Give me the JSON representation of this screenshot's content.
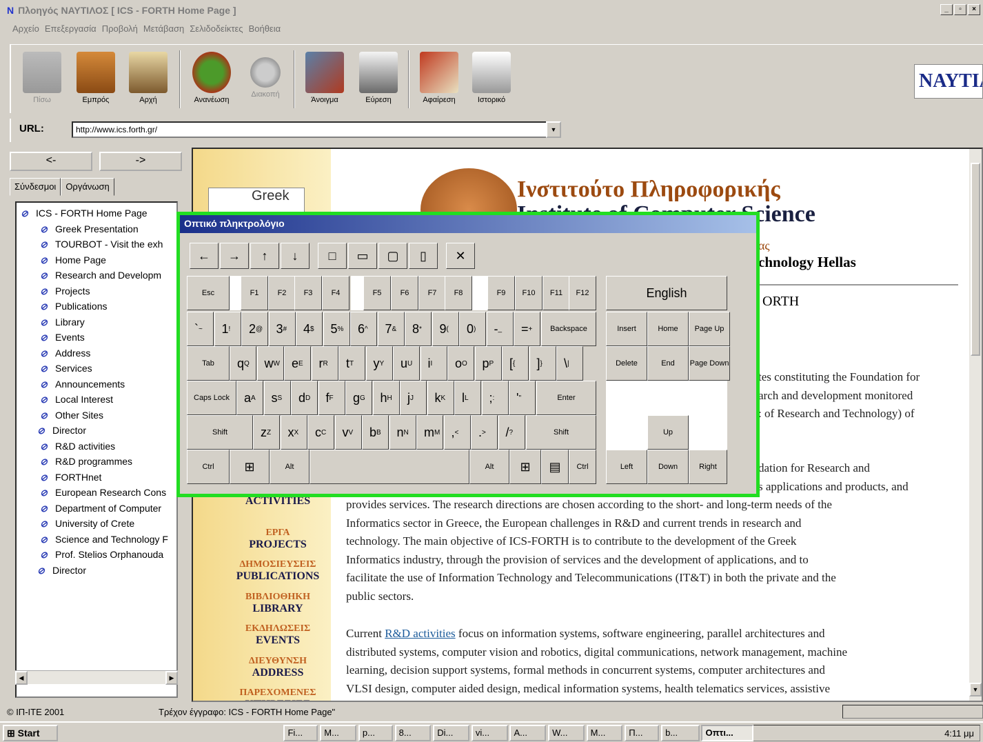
{
  "window": {
    "title": "Πλοηγός ΝΑΥΤΙΛΟΣ [ ICS - FORTH Home Page ]",
    "logo": "N",
    "controls": [
      "_",
      "▫",
      "×"
    ]
  },
  "menu": [
    "Αρχείο",
    "Επεξεργασία",
    "Προβολή",
    "Μετάβαση",
    "Σελιδοδείκτες",
    "Βοήθεια"
  ],
  "toolbar": {
    "buttons": [
      {
        "label": "Πίσω",
        "icon": "back-sign-icon",
        "disabled": true
      },
      {
        "label": "Εμπρός",
        "icon": "forward-sign-icon",
        "disabled": false
      },
      {
        "label": "Αρχή",
        "icon": "home-icon",
        "disabled": false
      },
      {
        "label": "Ανανέωση",
        "icon": "reload-icon",
        "disabled": false
      },
      {
        "label": "Διακοπή",
        "icon": "stop-icon",
        "disabled": true
      },
      {
        "label": "Άνοιγμα",
        "icon": "open-icon",
        "disabled": false
      },
      {
        "label": "Εύρεση",
        "icon": "find-icon",
        "disabled": false
      },
      {
        "label": "Αφαίρεση",
        "icon": "remove-icon",
        "disabled": false
      },
      {
        "label": "Ιστορικό",
        "icon": "history-icon",
        "disabled": false
      }
    ],
    "brand": "NAYTIΛΟΣ"
  },
  "url": {
    "label": "URL:",
    "value": "http://www.ics.forth.gr/"
  },
  "sidebar": {
    "back": "<-",
    "forward": "->",
    "tabs": [
      "Σύνδεσμοι",
      "Οργάνωση"
    ],
    "items": [
      "ICS - FORTH Home Page",
      "Greek Presentation",
      "TOURBOT - Visit the exh",
      "Home Page",
      "Research and Developm",
      "Projects",
      "Publications",
      "Library",
      "Events",
      "Address",
      "Services",
      "Announcements",
      "Local Interest",
      "Other Sites",
      "Director",
      "R&D activities",
      "R&D programmes",
      "FORTHnet",
      "European Research Cons",
      "Department of Computer",
      "University of Crete",
      "Science and Technology F",
      "Prof. Stelios Orphanouda",
      "Director"
    ]
  },
  "page": {
    "greek_logo": "Greek",
    "title_gr": "Ινστιτούτο Πληροφορικής",
    "title_en": "Institute of Computer Science",
    "sub1_gr": "ας",
    "sub1_en": "chnology Hellas",
    "sub2": "ORTH",
    "nav": [
      {
        "gr": "",
        "en": "ACTIVITIES"
      },
      {
        "gr": "ΕΡΓΑ",
        "en": "PROJECTS"
      },
      {
        "gr": "ΔΗΜΟΣΙΕΥΣΕΙΣ",
        "en": "PUBLICATIONS"
      },
      {
        "gr": "ΒΙΒΛΙΟΘΗΚΗ",
        "en": "LIBRARY"
      },
      {
        "gr": "ΕΚΔΗΛΩΣΕΙΣ",
        "en": "EVENTS"
      },
      {
        "gr": "ΔΙΕΥΘΥΝΣΗ",
        "en": "ADDRESS"
      },
      {
        "gr": "ΠΑΡΕΧΟΜΕΝΕΣ",
        "en": "ΥΠΗΡΕΣΙΕΣ"
      }
    ],
    "para1_tail": [
      "tes constituting the Foundation for",
      "arch and development monitored",
      ": of Research and Technology) of"
    ],
    "para2_tail": [
      "dation for Research and",
      "s applications and products, and"
    ],
    "para2": [
      "provides services. The research directions are chosen according to the short- and long-term needs of the",
      "Informatics sector in Greece, the European challenges in R&D and current trends in research and",
      "technology. The main objective of ICS-FORTH is to contribute to the development of the Greek",
      "Informatics industry, through the provision of services and the development of applications, and to",
      "facilitate the use of Information Technology and Telecommunications (IT&T) in both the private and the",
      "public sectors."
    ],
    "para3_lead": "Current ",
    "para3_link": "R&D activities",
    "para3_first": " focus on information systems, software engineering, parallel architectures and",
    "para3": [
      "distributed systems, computer vision and robotics, digital communications, network management, machine",
      "learning, decision support systems, formal methods in concurrent systems, computer architectures and",
      "VLSI design, computer aided design, medical information systems, health telematics services, assistive"
    ]
  },
  "keyboard": {
    "title": "Οπτικό πληκτρολόγιο",
    "tools": [
      "←",
      "→",
      "↑",
      "↓",
      "□",
      "▭",
      "▢",
      "▯",
      "✕"
    ],
    "fn_row": [
      "Esc",
      "F1",
      "F2",
      "F3",
      "F4",
      "F5",
      "F6",
      "F7",
      "F8",
      "F9",
      "F10",
      "F11",
      "F12"
    ],
    "language": "English",
    "row1": [
      [
        "`",
        "~"
      ],
      [
        "1",
        "!"
      ],
      [
        "2",
        "@"
      ],
      [
        "3",
        "#"
      ],
      [
        "4",
        "$"
      ],
      [
        "5",
        "%"
      ],
      [
        "6",
        "^"
      ],
      [
        "7",
        "&"
      ],
      [
        "8",
        "*"
      ],
      [
        "9",
        "("
      ],
      [
        "0",
        ")"
      ],
      [
        "-",
        "_"
      ],
      [
        "=",
        "+"
      ]
    ],
    "backspace": "Backspace",
    "tab": "Tab",
    "row2": [
      [
        "q",
        "Q"
      ],
      [
        "w",
        "W"
      ],
      [
        "e",
        "E"
      ],
      [
        "r",
        "R"
      ],
      [
        "t",
        "T"
      ],
      [
        "y",
        "Y"
      ],
      [
        "u",
        "U"
      ],
      [
        "i",
        "I"
      ],
      [
        "o",
        "O"
      ],
      [
        "p",
        "P"
      ],
      [
        "[",
        "{"
      ],
      [
        "]",
        "}"
      ],
      [
        "\\",
        "|"
      ]
    ],
    "capslock": "Caps Lock",
    "row3": [
      [
        "a",
        "A"
      ],
      [
        "s",
        "S"
      ],
      [
        "d",
        "D"
      ],
      [
        "f",
        "F"
      ],
      [
        "g",
        "G"
      ],
      [
        "h",
        "H"
      ],
      [
        "j",
        "J"
      ],
      [
        "k",
        "K"
      ],
      [
        "l",
        "L"
      ],
      [
        ";",
        ":"
      ],
      [
        "'",
        "\""
      ]
    ],
    "enter": "Enter",
    "shift": "Shift",
    "row4": [
      [
        "z",
        "Z"
      ],
      [
        "x",
        "X"
      ],
      [
        "c",
        "C"
      ],
      [
        "v",
        "V"
      ],
      [
        "b",
        "B"
      ],
      [
        "n",
        "N"
      ],
      [
        "m",
        "M"
      ],
      [
        ",",
        "<"
      ],
      [
        ".",
        ">"
      ],
      [
        "/",
        "?"
      ]
    ],
    "ctrl": "Ctrl",
    "alt": "Alt",
    "nav": [
      "Insert",
      "Home",
      "Page Up",
      "Delete",
      "End",
      "Page Down"
    ],
    "arrows": {
      "up": "Up",
      "left": "Left",
      "down": "Down",
      "right": "Right"
    }
  },
  "status": {
    "left": "© ΙΠ-ΙΤΕ 2001",
    "doc": "Τρέχον έγγραφο: ICS - FORTH Home Page\""
  },
  "taskbar": {
    "start": "Start",
    "tasks": [
      "Fi...",
      "M...",
      "p...",
      "8...",
      "Di...",
      "vi...",
      "A...",
      "W...",
      "M...",
      "Π...",
      "b...",
      "Οπτι..."
    ],
    "clock": "4:11 μμ"
  }
}
